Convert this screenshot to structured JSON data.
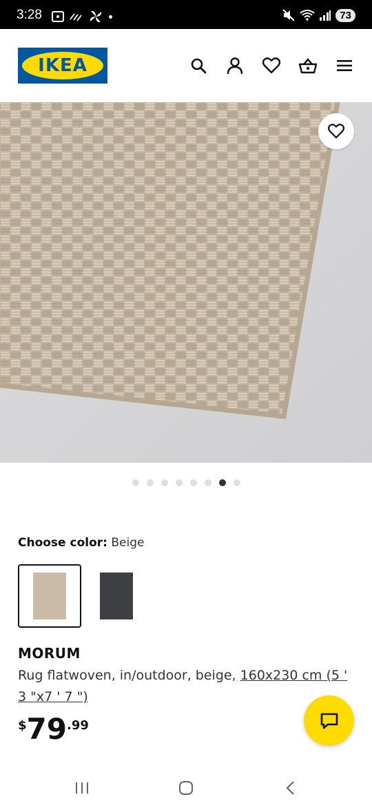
{
  "status_bar": {
    "time": "3:28",
    "battery": "73"
  },
  "header": {
    "logo_text": "IKEA",
    "icons": [
      "search-icon",
      "account-icon",
      "heart-icon",
      "basket-icon",
      "menu-icon"
    ]
  },
  "gallery": {
    "image_count": 8,
    "active_index": 6
  },
  "color_picker": {
    "label": "Choose color:",
    "value": "Beige",
    "options": [
      {
        "name": "Beige",
        "color": "#c9bba6",
        "selected": true
      },
      {
        "name": "Dark gray",
        "color": "#3d3f42",
        "selected": false
      }
    ]
  },
  "product": {
    "name": "MORUM",
    "description": "Rug flatwoven, in/outdoor, beige, ",
    "size_link": "160x230 cm (5 ' 3 \"x7 ' 7 \")",
    "price_currency": "$",
    "price_int": "79",
    "price_dec": ".99"
  },
  "colors": {
    "brand_blue": "#0058a3",
    "brand_yellow": "#ffdb00"
  }
}
